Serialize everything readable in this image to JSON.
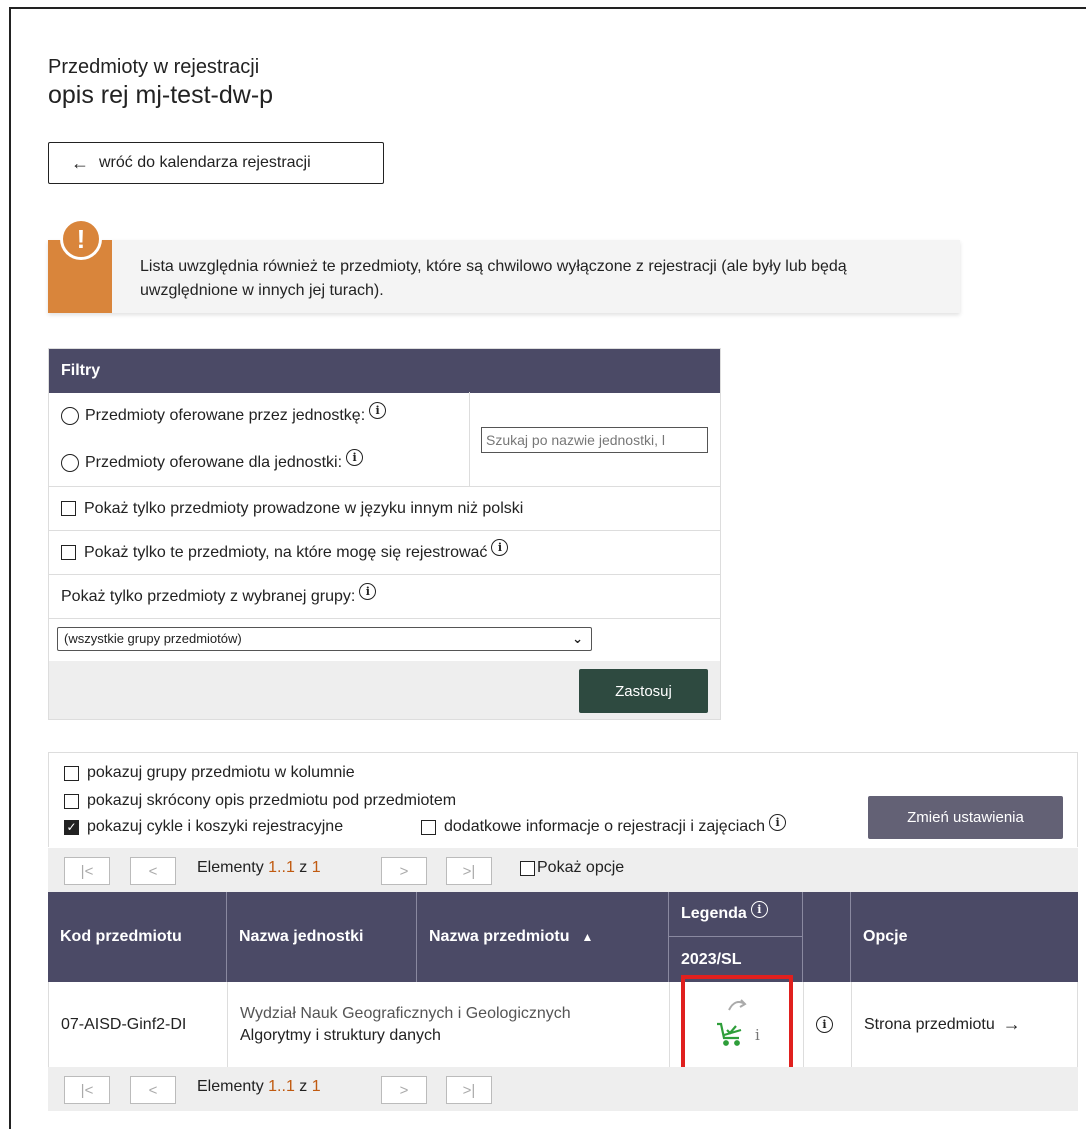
{
  "page": {
    "subtitle": "Przedmioty w rejestracji",
    "title": "opis rej mj-test-dw-p",
    "back_label": "wróć do kalendarza rejestracji"
  },
  "notice": {
    "text": "Lista uwzględnia również te przedmioty, które są chwilowo wyłączone z rejestracji (ale były lub będą uwzględnione w innych jej turach)."
  },
  "filters": {
    "header": "Filtry",
    "radio_by_unit": "Przedmioty oferowane przez jednostkę:",
    "radio_for_unit": "Przedmioty oferowane dla jednostki:",
    "search_placeholder": "Szukaj po nazwie jednostki, l",
    "non_polish": "Pokaż tylko przedmioty prowadzone w języku innym niż polski",
    "can_register": "Pokaż tylko te przedmioty, na które mogę się rejestrować",
    "group_label": "Pokaż tylko przedmioty z wybranej grupy:",
    "group_selected": "(wszystkie grupy przedmiotów)",
    "apply_label": "Zastosuj"
  },
  "settings": {
    "show_groups": "pokazuj grupy przedmiotu w kolumnie",
    "show_short_desc": "pokazuj skrócony opis przedmiotu pod przedmiotem",
    "show_cycles": "pokazuj cykle i koszyki rejestracyjne",
    "extra_info": "dodatkowe informacje o rejestracji i zajęciach",
    "change_label": "Zmień ustawienia"
  },
  "pager": {
    "first": "|<",
    "prev": "<",
    "next": ">",
    "last": ">|",
    "elements_label": "Elementy",
    "range": "1..1",
    "of": "z",
    "total": "1",
    "show_options": "Pokaż opcje"
  },
  "table": {
    "col_code": "Kod przedmiotu",
    "col_unit": "Nazwa jednostki",
    "col_name": "Nazwa przedmiotu",
    "col_legend": "Legenda",
    "col_cycle": "2023/SL",
    "col_options": "Opcje",
    "rows": [
      {
        "code": "07-AISD-Ginf2-DI",
        "unit": "Wydział Nauk Geograficznych i Geologicznych",
        "name": "Algorytmy i struktury danych",
        "option": "Strona przedmiotu"
      }
    ]
  },
  "colors": {
    "header_bg": "#4b4a66",
    "accent_orange": "#d9853b",
    "apply_bg": "#2e4a40",
    "cart_green": "#2e9e3a",
    "highlight_red": "#e0201e"
  }
}
